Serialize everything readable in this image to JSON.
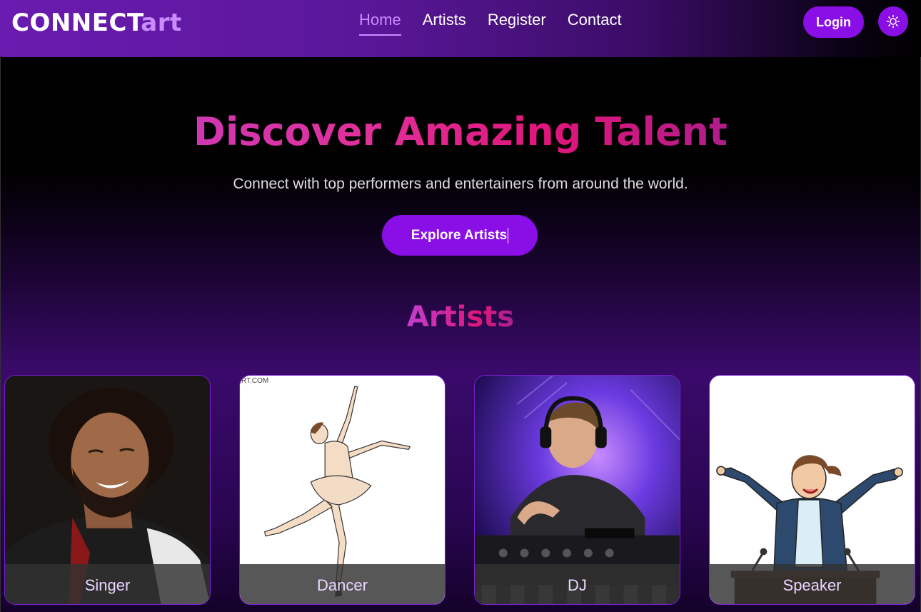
{
  "brand": {
    "part1": "CONNECT",
    "part2": "art"
  },
  "nav": {
    "items": [
      {
        "label": "Home",
        "active": true
      },
      {
        "label": "Artists",
        "active": false
      },
      {
        "label": "Register",
        "active": false
      },
      {
        "label": "Contact",
        "active": false
      }
    ],
    "login_label": "Login",
    "theme_icon": "sun-icon"
  },
  "hero": {
    "title": "Discover Amazing Talent",
    "subtitle": "Connect with top performers and entertainers from around the world.",
    "cta_label": "Explore Artists"
  },
  "artists_section": {
    "title": "Artists",
    "cards": [
      {
        "label": "Singer"
      },
      {
        "label": "Dancer",
        "watermark": "RT.COM"
      },
      {
        "label": "DJ"
      },
      {
        "label": "Speaker"
      }
    ]
  },
  "colors": {
    "accent": "#8a0ee6",
    "accent_light": "#c98cff",
    "title_pink": "#e0157a"
  }
}
